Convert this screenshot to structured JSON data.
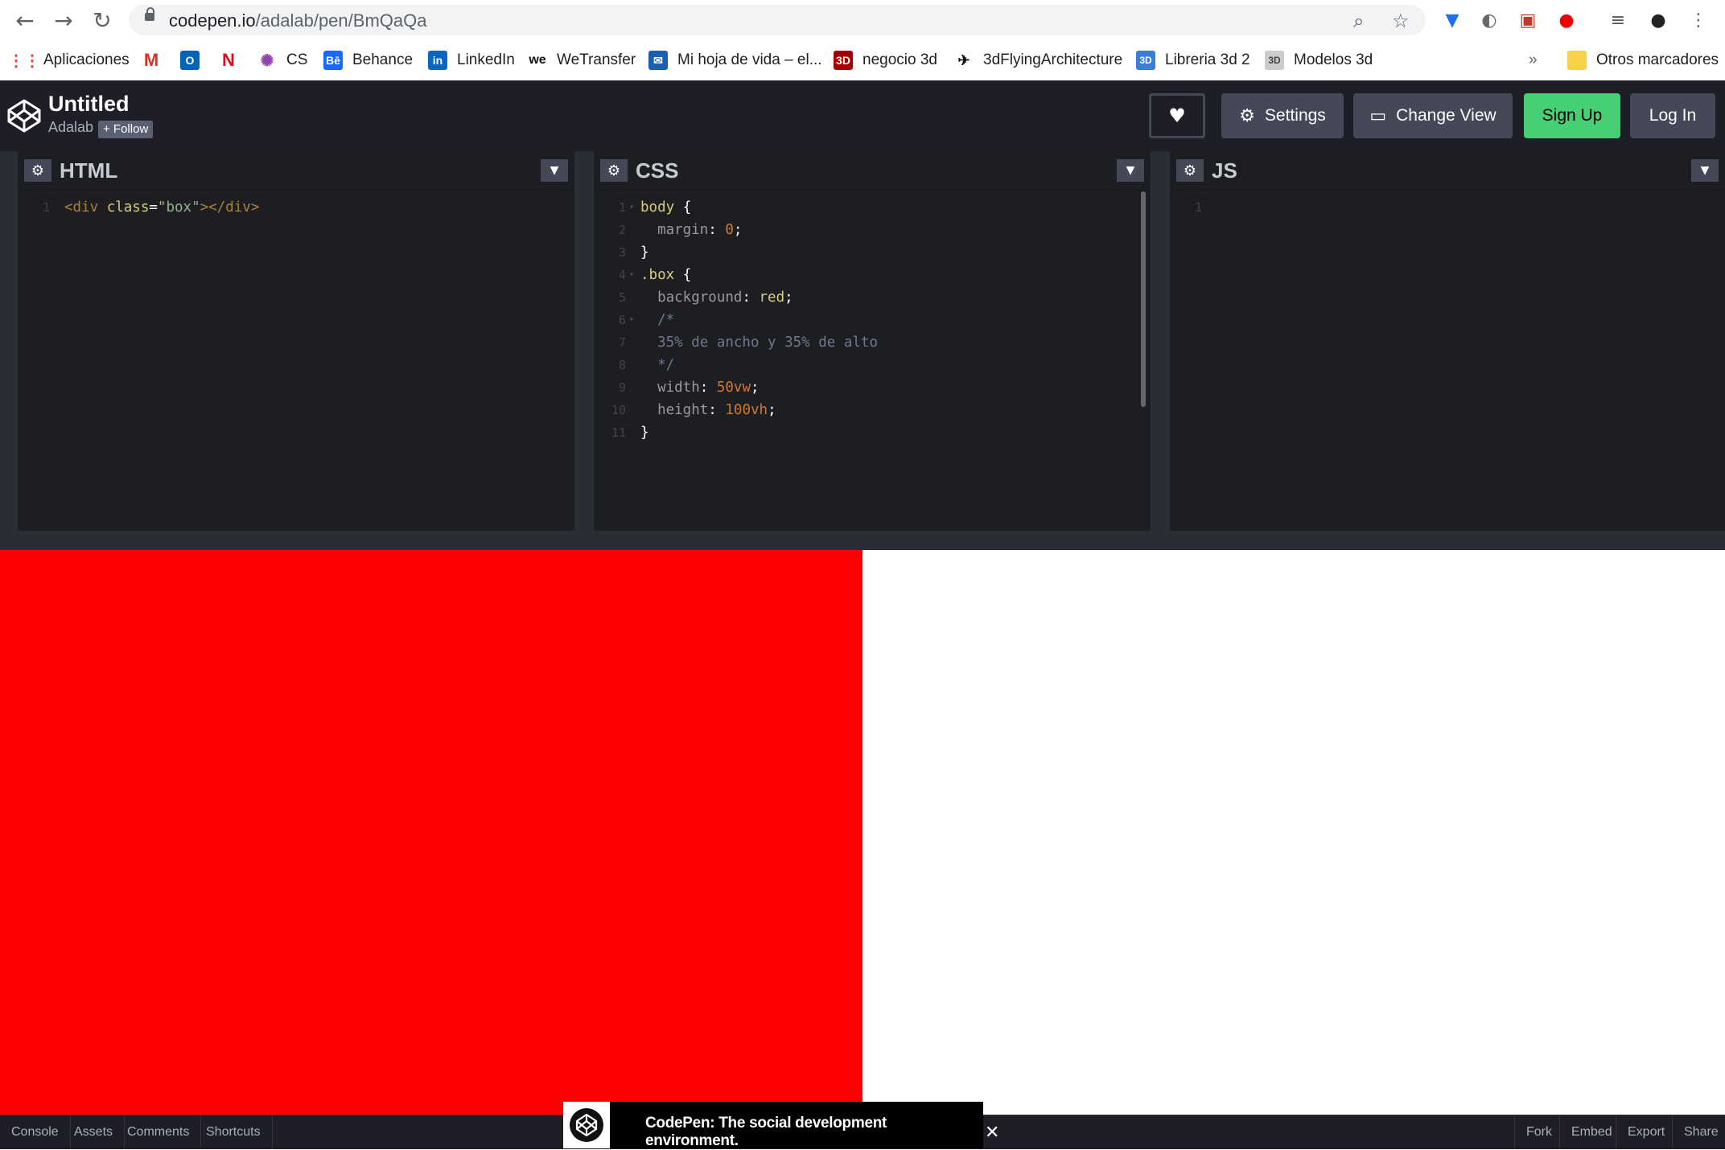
{
  "browser": {
    "url_host": "codepen.io",
    "url_path": "/adalab/pen/BmQaQa",
    "bookmarks": [
      {
        "label": "Aplicaciones",
        "icon": "apps-grid-icon"
      },
      {
        "label": "",
        "icon": "gmail-icon"
      },
      {
        "label": "",
        "icon": "outlook-icon"
      },
      {
        "label": "",
        "icon": "netflix-icon"
      },
      {
        "label": "CS",
        "icon": "cs-icon"
      },
      {
        "label": "Behance",
        "icon": "behance-icon"
      },
      {
        "label": "LinkedIn",
        "icon": "linkedin-icon"
      },
      {
        "label": "WeTransfer",
        "icon": "wetransfer-icon"
      },
      {
        "label": "Mi hoja de vida – el...",
        "icon": "mail-icon"
      },
      {
        "label": "negocio 3d",
        "icon": "3d-icon"
      },
      {
        "label": "3dFlyingArchitecture",
        "icon": "flying-icon"
      },
      {
        "label": "Libreria 3d 2",
        "icon": "3d-blue-icon"
      },
      {
        "label": "Modelos 3d",
        "icon": "3d-gray-icon"
      }
    ],
    "more": "»",
    "other_bookmarks": "Otros marcadores"
  },
  "header": {
    "title": "Untitled",
    "author": "Adalab",
    "follow": "+ Follow",
    "settings": "Settings",
    "change_view": "Change View",
    "sign_up": "Sign Up",
    "log_in": "Log In"
  },
  "editors": {
    "html": {
      "title": "HTML"
    },
    "css": {
      "title": "CSS"
    },
    "js": {
      "title": "JS",
      "line1": "1"
    }
  },
  "html_code": [
    {
      "n": "1",
      "segments": [
        [
          "<div ",
          "tag"
        ],
        [
          "class",
          "attr"
        ],
        [
          "=",
          "punc"
        ],
        [
          "\"box\"",
          "str"
        ],
        [
          "></div>",
          "tag"
        ]
      ]
    }
  ],
  "css_code": [
    {
      "n": "1",
      "fold": "▾",
      "segments": [
        [
          "body",
          "sel"
        ],
        [
          " {",
          "punc"
        ]
      ]
    },
    {
      "n": "2",
      "segments": [
        [
          "  margin",
          "prop"
        ],
        [
          ": ",
          "punc"
        ],
        [
          "0",
          "val"
        ],
        [
          ";",
          "punc"
        ]
      ]
    },
    {
      "n": "3",
      "segments": [
        [
          "}",
          "punc"
        ]
      ]
    },
    {
      "n": "4",
      "fold": "▾",
      "segments": [
        [
          ".box",
          "sel"
        ],
        [
          " {",
          "punc"
        ]
      ]
    },
    {
      "n": "5",
      "segments": [
        [
          "  background",
          "prop"
        ],
        [
          ": ",
          "punc"
        ],
        [
          "red",
          "kw"
        ],
        [
          ";",
          "punc"
        ]
      ]
    },
    {
      "n": "6",
      "fold": "▾",
      "segments": [
        [
          "  /*",
          "cmt"
        ]
      ]
    },
    {
      "n": "7",
      "segments": [
        [
          "  35% de ancho y 35% de alto",
          "cmt"
        ]
      ]
    },
    {
      "n": "8",
      "segments": [
        [
          "  */",
          "cmt"
        ]
      ]
    },
    {
      "n": "9",
      "segments": [
        [
          "  width",
          "prop"
        ],
        [
          ": ",
          "punc"
        ],
        [
          "50vw",
          "val"
        ],
        [
          ";",
          "punc"
        ]
      ]
    },
    {
      "n": "10",
      "segments": [
        [
          "  height",
          "prop"
        ],
        [
          ": ",
          "punc"
        ],
        [
          "100vh",
          "val"
        ],
        [
          ";",
          "punc"
        ]
      ]
    },
    {
      "n": "11",
      "segments": [
        [
          "}",
          "punc"
        ]
      ]
    }
  ],
  "preview": {
    "box_color": "#ff0000",
    "box_width_vw": 50,
    "box_height_vh": 100
  },
  "bottom": {
    "left": [
      "Console",
      "Assets",
      "Comments",
      "Shortcuts"
    ],
    "right": [
      "Fork",
      "Embed",
      "Export",
      "Share"
    ]
  },
  "toast": {
    "text": "CodePen: The social development environment.",
    "close": "✕"
  }
}
